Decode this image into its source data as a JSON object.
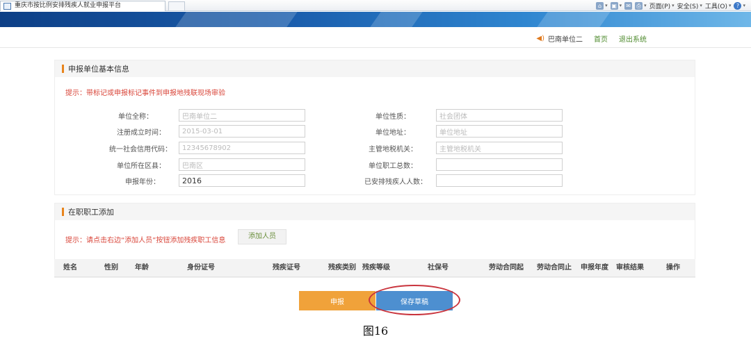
{
  "browser": {
    "tab_title": "重庆市按比例安排残疾人就业申报平台",
    "toolbar": [
      {
        "icon": "home-icon",
        "label": ""
      },
      {
        "icon": "feed-icon",
        "label": ""
      },
      {
        "icon": "mail-icon",
        "label": ""
      },
      {
        "icon": "print-icon",
        "label": ""
      },
      {
        "icon": "page-icon",
        "label": "页面(P)"
      },
      {
        "icon": "security-icon",
        "label": "安全(S)"
      },
      {
        "icon": "tools-icon",
        "label": "工具(O)"
      },
      {
        "icon": "help-icon",
        "label": ""
      }
    ]
  },
  "topnav": {
    "user_name": "巴南单位二",
    "home_link": "首页",
    "logout_link": "退出系统"
  },
  "unit_info": {
    "section_title": "申报单位基本信息",
    "hint": "提示：带标记或申报标记事件到申报地残联现场审验",
    "fields": {
      "unit_name": {
        "label": "单位全称：",
        "value": "巴南单位二"
      },
      "unit_type": {
        "label": "单位性质：",
        "value": "社会团体"
      },
      "reg_date": {
        "label": "注册成立时间：",
        "value": "2015-03-01"
      },
      "unit_address": {
        "label": "单位地址：",
        "value": "单位地址"
      },
      "credit_code": {
        "label": "统一社会信用代码：",
        "value": "12345678902"
      },
      "authority": {
        "label": "主管地税机关：",
        "value": "主管地税机关"
      },
      "district": {
        "label": "单位所在区县：",
        "value": "巴南区"
      },
      "staff_total": {
        "label": "单位职工总数：",
        "value": ""
      },
      "year": {
        "label": "申报年份：",
        "value": "2016"
      },
      "disabled_count": {
        "label": "已安排残疾人人数：",
        "value": ""
      }
    }
  },
  "staff_section": {
    "section_title": "在职职工添加",
    "hint": "提示：请点击右边“添加人员”按钮添加残疾职工信息",
    "add_button": "添加人员",
    "columns": [
      "姓名",
      "性别",
      "年龄",
      "身份证号",
      "残疾证号",
      "残疾类别",
      "残疾等级",
      "社保号",
      "劳动合同起",
      "劳动合同止",
      "申报年度",
      "审核结果",
      "操作"
    ]
  },
  "actions": {
    "submit": "申报",
    "save_draft": "保存草稿"
  },
  "caption": "图16",
  "colors": {
    "accent_orange": "#f0a23a",
    "accent_blue": "#4d8fd0",
    "hint_red": "#d9463a",
    "highlight_circle": "#c9343d"
  }
}
